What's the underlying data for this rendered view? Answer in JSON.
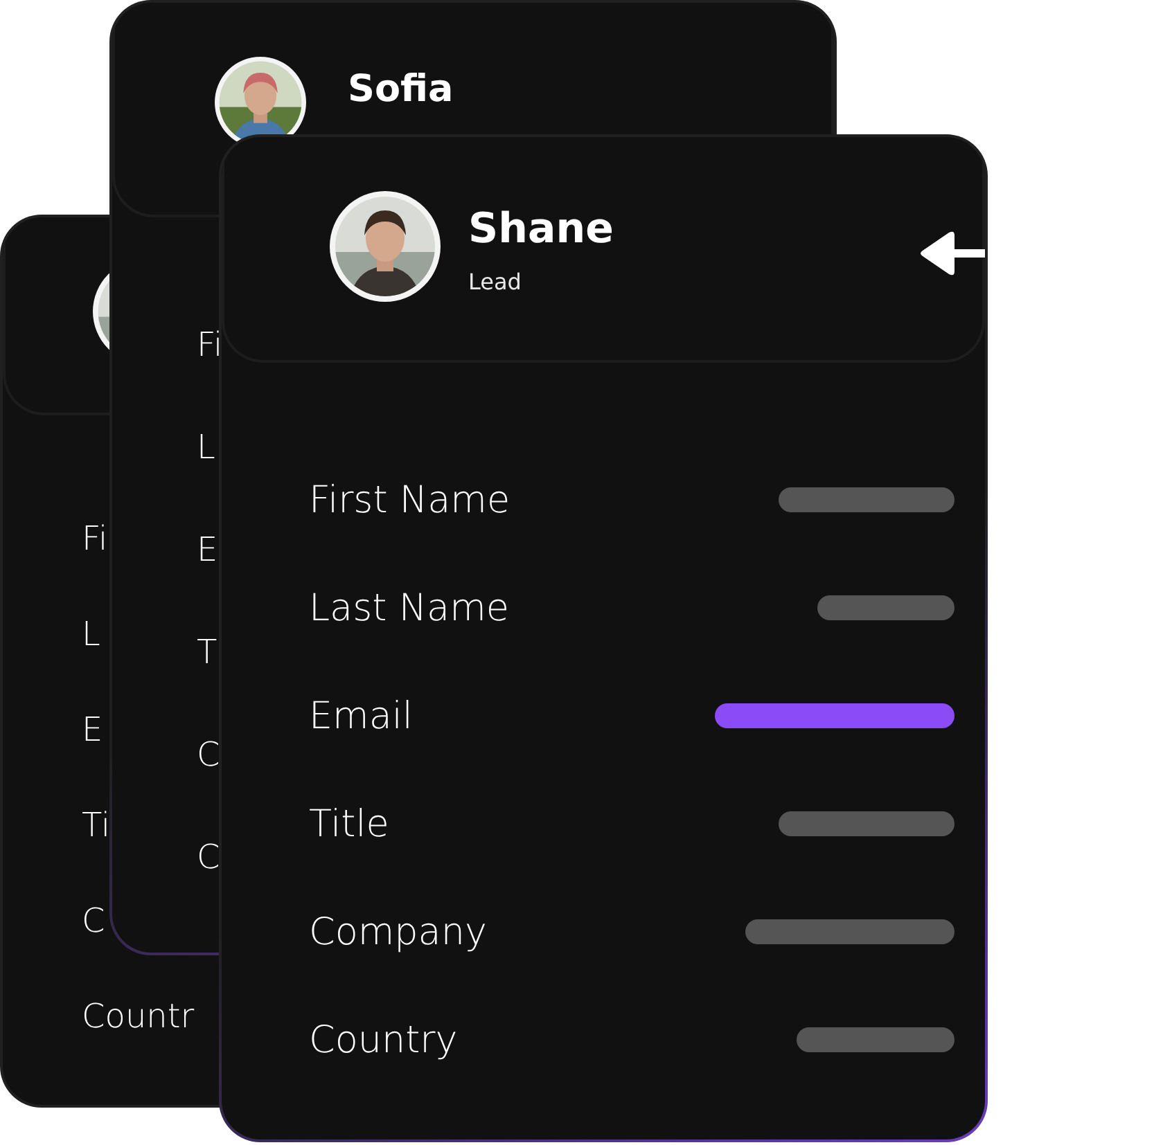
{
  "cards": [
    {
      "kind": "back",
      "fields": [
        {
          "label": "Fi"
        },
        {
          "label": "L"
        },
        {
          "label": "E"
        },
        {
          "label": "Ti"
        },
        {
          "label": "C"
        },
        {
          "label": "Countr"
        }
      ]
    },
    {
      "kind": "middle",
      "name": "Sofia",
      "fields": [
        {
          "label": "Fi"
        },
        {
          "label": "L"
        },
        {
          "label": "E"
        },
        {
          "label": "T"
        },
        {
          "label": "C"
        },
        {
          "label": "C"
        }
      ]
    },
    {
      "kind": "front",
      "name": "Shane",
      "role": "Lead",
      "fields": [
        {
          "label": "First Name",
          "selected": false
        },
        {
          "label": "Last Name",
          "selected": false
        },
        {
          "label": "Email",
          "selected": true
        },
        {
          "label": "Title",
          "selected": false
        },
        {
          "label": "Company",
          "selected": false
        },
        {
          "label": "Country",
          "selected": false
        }
      ]
    }
  ]
}
